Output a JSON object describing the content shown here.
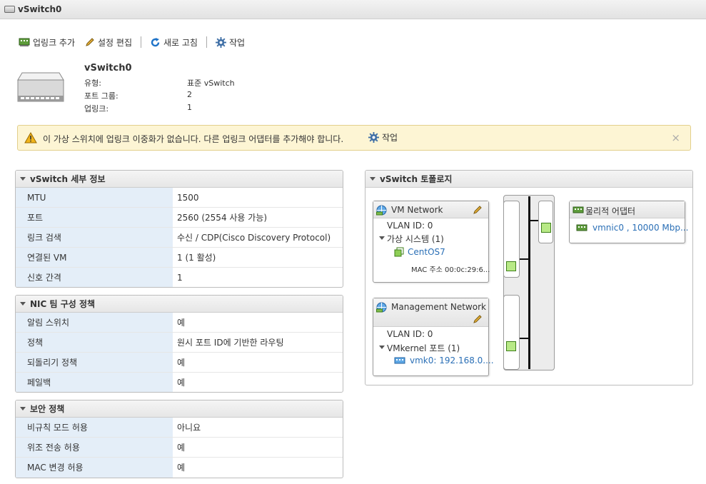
{
  "window": {
    "title": "vSwitch0"
  },
  "toolbar": {
    "add_uplink": "업링크 추가",
    "edit_settings": "설정 편집",
    "refresh": "새로 고침",
    "actions": "작업"
  },
  "summary": {
    "name": "vSwitch0",
    "rows": [
      {
        "label": "유형:",
        "value": "표준 vSwitch"
      },
      {
        "label": "포트 그룹:",
        "value": "2"
      },
      {
        "label": "업링크:",
        "value": "1"
      }
    ]
  },
  "warning": {
    "text": "이 가상 스위치에 업링크 이중화가 없습니다. 다른 업링크 어댑터를 추가해야 합니다.",
    "action": "작업",
    "close": "×"
  },
  "details": {
    "title": "vSwitch 세부 정보",
    "rows": [
      {
        "label": "MTU",
        "value": "1500"
      },
      {
        "label": "포트",
        "value": "2560 (2554 사용 가능)"
      },
      {
        "label": "링크 검색",
        "value": "수신 / CDP(Cisco Discovery Protocol)"
      },
      {
        "label": "연결된 VM",
        "value": "1 (1 활성)"
      },
      {
        "label": "신호 간격",
        "value": "1"
      }
    ]
  },
  "nic_teaming": {
    "title": "NIC 팀 구성 정책",
    "rows": [
      {
        "label": "알림 스위치",
        "value": "예"
      },
      {
        "label": "정책",
        "value": "원시 포트 ID에 기반한 라우팅"
      },
      {
        "label": "되돌리기 정책",
        "value": "예"
      },
      {
        "label": "페일백",
        "value": "예"
      }
    ]
  },
  "security": {
    "title": "보안 정책",
    "rows": [
      {
        "label": "비규칙 모드 허용",
        "value": "아니요"
      },
      {
        "label": "위조 전송 허용",
        "value": "예"
      },
      {
        "label": "MAC 변경 허용",
        "value": "예"
      }
    ]
  },
  "topology": {
    "title": "vSwitch 토폴로지",
    "vm_network": {
      "name": "VM Network",
      "vlan": "VLAN ID: 0",
      "group_label": "가상 시스템 (1)",
      "vm_name": "CentOS7",
      "mac": "MAC 주소 00:0c:29:6..."
    },
    "mgmt_network": {
      "name": "Management Network",
      "vlan": "VLAN ID: 0",
      "group_label": "VMkernel 포트 (1)",
      "vmk": "vmk0: 192.168.0...."
    },
    "physical": {
      "title": "물리적 어댑터",
      "nic": "vmnic0 , 10000 Mbp..."
    }
  },
  "colors": {
    "accent_link": "#2a6fb6",
    "warning_bg": "#fdf5d4",
    "key_cell_bg": "#e4eef8",
    "port_green": "#b8e986"
  }
}
